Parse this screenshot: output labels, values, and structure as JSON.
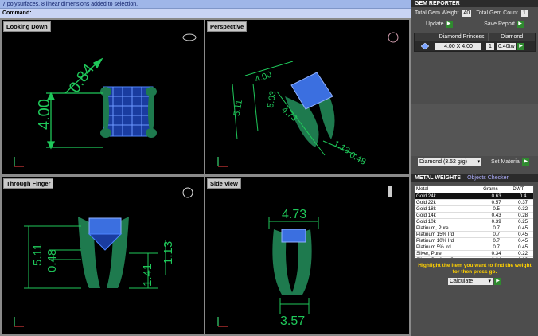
{
  "command": {
    "history": "7 polysurfaces, 8 linear dimensions added to selection.",
    "prompt": "Command:"
  },
  "viewports": {
    "top_left": {
      "title": "Looking Down",
      "dims": [
        "0.84",
        "4.00"
      ]
    },
    "top_right": {
      "title": "Perspective",
      "dims": [
        "5.11",
        "4.00",
        "5.03",
        "4.73",
        "1.13",
        "0.48"
      ]
    },
    "bottom_left": {
      "title": "Through Finger",
      "dims": [
        "5.11",
        "0.48",
        "1.41",
        "1.13"
      ]
    },
    "bottom_right": {
      "title": "Side View",
      "dims": [
        "4.73",
        "3.57"
      ]
    }
  },
  "gem_reporter": {
    "title": "GEM REPORTER",
    "total_weight_label": "Total Gem Weight",
    "total_weight_value": "40",
    "total_count_label": "Total Gem Count",
    "total_count_value": "1",
    "update_label": "Update",
    "save_report_label": "Save Report",
    "table_headers": [
      "Diamond Princess",
      "Diamond"
    ],
    "row": {
      "size": "4.00 X 4.00",
      "count": "1",
      "weight": "0.40tw"
    },
    "material_select": "Diamond    (3.52 g/g)",
    "set_material_label": "Set Material"
  },
  "metal_weights": {
    "tab_active": "METAL WEIGHTS",
    "tab_inactive": "Objects Checker",
    "columns": [
      "Metal",
      "Grams",
      "DWT"
    ],
    "rows": [
      {
        "metal": "Gold 24k",
        "grams": "0.63",
        "dwt": "0.4",
        "selected": true
      },
      {
        "metal": "Gold 22k",
        "grams": "0.57",
        "dwt": "0.37"
      },
      {
        "metal": "Gold 18k",
        "grams": "0.5",
        "dwt": "0.32"
      },
      {
        "metal": "Gold 14k",
        "grams": "0.43",
        "dwt": "0.28"
      },
      {
        "metal": "Gold 10k",
        "grams": "0.39",
        "dwt": "0.25"
      },
      {
        "metal": "Platinum, Pure",
        "grams": "0.7",
        "dwt": "0.45"
      },
      {
        "metal": "Platinum 15% Ird",
        "grams": "0.7",
        "dwt": "0.45"
      },
      {
        "metal": "Platinum 10% Ird",
        "grams": "0.7",
        "dwt": "0.45"
      },
      {
        "metal": "Platinum 5% Ird",
        "grams": "0.7",
        "dwt": "0.45"
      },
      {
        "metal": "Silver, Pure",
        "grams": "0.34",
        "dwt": "0.22"
      },
      {
        "metal": "Silver, Sterling (9",
        "grams": "0.34",
        "dwt": "0.22"
      }
    ],
    "hint": "Highlight the item you want to find the weight for then press go.",
    "calculate_label": "Calculate"
  },
  "colors": {
    "dimension_green": "#1fc85a",
    "prong_green": "#1e7a4e",
    "gem_blue": "#3b6fe0",
    "panel_bg": "#4d4d4d"
  }
}
